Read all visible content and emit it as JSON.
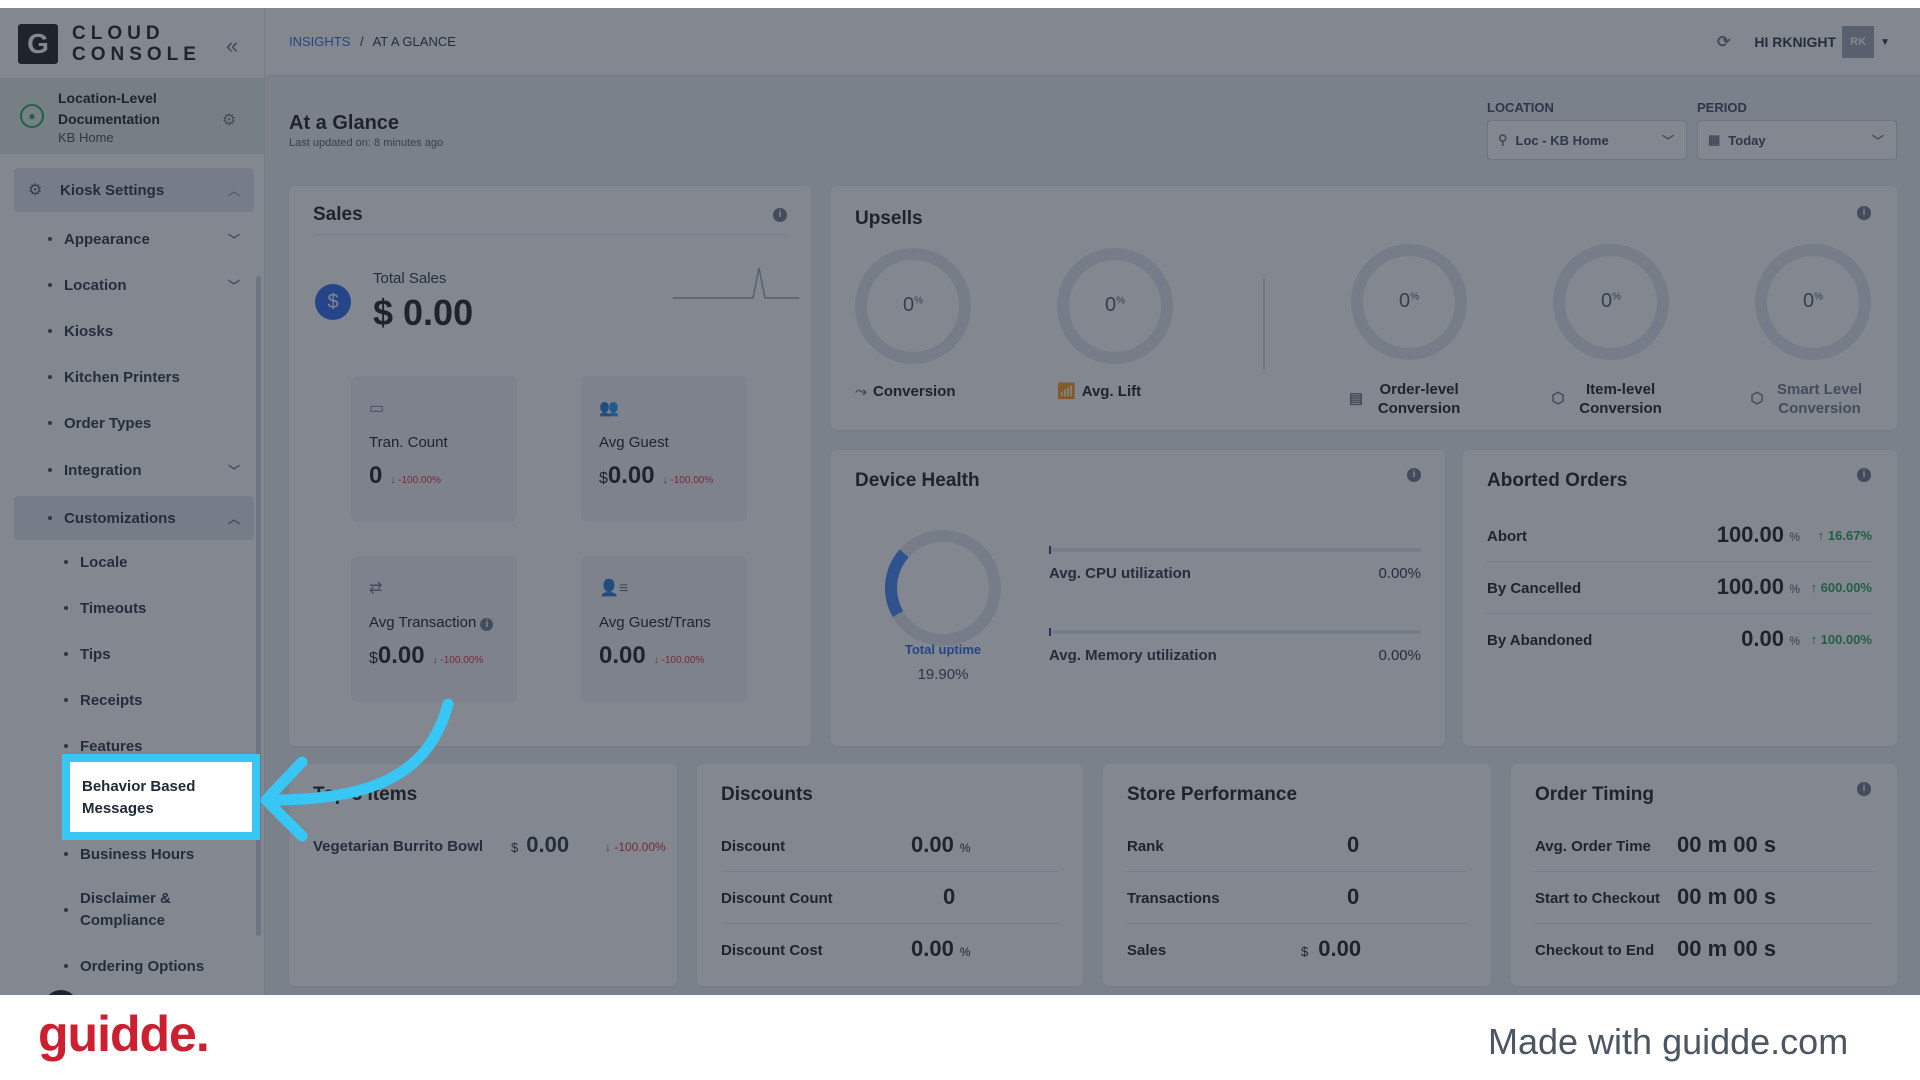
{
  "sidebar": {
    "logo_letter": "G",
    "logo_line1": "CLOUD",
    "logo_line2": "CONSOLE",
    "collapse_icon": "«",
    "org_name": "Location-Level Documentation",
    "org_sub": "KB Home",
    "section": "Kiosk Settings",
    "items": {
      "appearance": "Appearance",
      "location": "Location",
      "kiosks": "Kiosks",
      "kitchen_printers": "Kitchen Printers",
      "order_types": "Order Types",
      "integration": "Integration",
      "customizations": "Customizations",
      "locale": "Locale",
      "timeouts": "Timeouts",
      "tips": "Tips",
      "receipts": "Receipts",
      "features": "Features",
      "behavior": "Behavior Based Messages",
      "business_hours": "Business Hours",
      "disclaimer": "Disclaimer & Compliance",
      "ordering_options": "Ordering Options"
    }
  },
  "header": {
    "crumb_root": "INSIGHTS",
    "crumb_sep": "/",
    "crumb_current": "AT A GLANCE",
    "greeting": "HI RKNIGHT",
    "avatar": "RK"
  },
  "page": {
    "title": "At a Glance",
    "updated": "Last updated on: 8 minutes ago",
    "location_label": "LOCATION",
    "location_value": "Loc - KB Home",
    "period_label": "PERIOD",
    "period_value": "Today"
  },
  "sales": {
    "title": "Sales",
    "total_label": "Total Sales",
    "total_value": "$ 0.00",
    "tiles": {
      "tran_label": "Tran. Count",
      "tran_value": "0",
      "tran_delta": "↓ -100.00%",
      "guest_label": "Avg Guest",
      "guest_cur": "$",
      "guest_value": "0.00",
      "guest_delta": "↓ -100.00%",
      "trans_label": "Avg Transaction",
      "trans_cur": "$",
      "trans_value": "0.00",
      "trans_delta": "↓ -100.00%",
      "gpt_label": "Avg Guest/Trans",
      "gpt_value": "0.00",
      "gpt_delta": "↓ -100.00%"
    }
  },
  "upsells": {
    "title": "Upsells",
    "pct": "0",
    "pct_sign": "%",
    "conversion": "Conversion",
    "avg_lift": "Avg. Lift",
    "order_level": "Order-level Conversion",
    "item_level": "Item-level Conversion",
    "smart_level": "Smart Level Conversion"
  },
  "device": {
    "title": "Device Health",
    "uptime_label": "Total uptime",
    "uptime_value": "19.90%",
    "cpu_label": "Avg. CPU utilization",
    "cpu_value": "0.00%",
    "mem_label": "Avg. Memory utilization",
    "mem_value": "0.00%"
  },
  "aborted": {
    "title": "Aborted Orders",
    "pct": "%",
    "rows": {
      "abort_label": "Abort",
      "abort_value": "100.00",
      "abort_delta": "↑ 16.67%",
      "cancel_label": "By Cancelled",
      "cancel_value": "100.00",
      "cancel_delta": "↑ 600.00%",
      "aband_label": "By Abandoned",
      "aband_value": "0.00",
      "aband_delta": "↑ 100.00%"
    }
  },
  "top_items": {
    "title": "Top 3 Items",
    "item": "Vegetarian Burrito Bowl",
    "cur": "$",
    "value": "0.00",
    "delta": "↓ -100.00%"
  },
  "discounts": {
    "title": "Discounts",
    "d_label": "Discount",
    "d_value": "0.00",
    "d_pct": "%",
    "dc_label": "Discount Count",
    "dc_value": "0",
    "dcost_label": "Discount Cost",
    "dcost_value": "0.00",
    "dcost_pct": "%"
  },
  "store": {
    "title": "Store Performance",
    "rank_label": "Rank",
    "rank_value": "0",
    "trans_label": "Transactions",
    "trans_value": "0",
    "sales_label": "Sales",
    "sales_cur": "$",
    "sales_value": "0.00"
  },
  "timing": {
    "title": "Order Timing",
    "avg_label": "Avg. Order Time",
    "avg_value": "00 m 00 s",
    "start_label": "Start to Checkout",
    "start_value": "00 m 00 s",
    "end_label": "Checkout to End",
    "end_value": "00 m 00 s"
  },
  "footer": {
    "brand": "guidde.",
    "made": "Made with guidde.com"
  },
  "colors": {
    "highlight": "#38c6f4",
    "brand": "#cc1f2f",
    "positive": "#16a34a",
    "negative": "#dc2626"
  }
}
